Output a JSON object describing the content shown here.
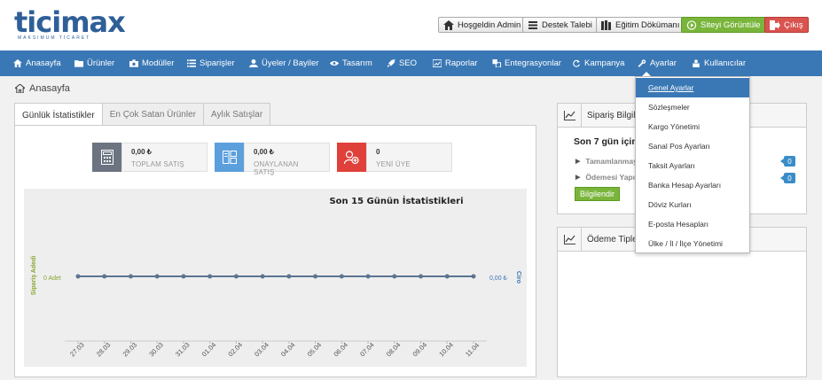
{
  "logo": {
    "name": "ticimax",
    "tagline": "MAKSIMUM TİCARET"
  },
  "header": {
    "welcome": "Hoşgeldin Admin",
    "support": "Destek Talebi",
    "docs": "Eğitim Dökümanı",
    "view_site": "Siteyi Görüntüle",
    "logout": "Çıkış"
  },
  "nav": {
    "items": [
      {
        "label": "Anasayfa",
        "icon": "home-icon"
      },
      {
        "label": "Ürünler",
        "icon": "folder-icon"
      },
      {
        "label": "Modüller",
        "icon": "camera-icon"
      },
      {
        "label": "Siparişler",
        "icon": "list-icon"
      },
      {
        "label": "Üyeler / Bayiler",
        "icon": "user-icon"
      },
      {
        "label": "Tasarım",
        "icon": "eye-icon"
      },
      {
        "label": "SEO",
        "icon": "rocket-icon"
      },
      {
        "label": "Raporlar",
        "icon": "chart-icon"
      },
      {
        "label": "Entegrasyonlar",
        "icon": "puzzle-icon"
      },
      {
        "label": "Kampanya",
        "icon": "refresh-icon"
      },
      {
        "label": "Ayarlar",
        "icon": "wrench-icon"
      },
      {
        "label": "Kullanıcılar",
        "icon": "user-lock-icon"
      }
    ]
  },
  "breadcrumb": {
    "label": "Anasayfa"
  },
  "tabs": [
    "Günlük İstatistikler",
    "En Çok Satan Ürünler",
    "Aylık Satışlar"
  ],
  "stats": [
    {
      "value": "0,00 ₺",
      "label": "TOPLAM SATIŞ",
      "color": "#6b7480"
    },
    {
      "value": "0,00 ₺",
      "label": "ONAYLANAN SATIŞ",
      "color": "#5b9fdc"
    },
    {
      "value": "0",
      "label": "YENİ ÜYE",
      "color": "#e0403a"
    }
  ],
  "chart_data": {
    "type": "line",
    "title": "Son 15 Günün İstatistikleri",
    "categories": [
      "27.03",
      "28.03",
      "29.03",
      "30.03",
      "31.03",
      "01.04",
      "02.04",
      "03.04",
      "04.04",
      "05.04",
      "06.04",
      "07.04",
      "08.04",
      "09.04",
      "10.04",
      "11.04"
    ],
    "series": [
      {
        "values": [
          0,
          0,
          0,
          0,
          0,
          0,
          0,
          0,
          0,
          0,
          0,
          0,
          0,
          0,
          0,
          0
        ]
      }
    ],
    "ylabel_left": "Sipariş Adedi",
    "ylabel_right": "Ciro",
    "left_tick": "0 Adet",
    "right_tick": "0,00 ₺",
    "colors": {
      "left_axis": "#8aa832",
      "right_axis": "#3a78b5",
      "line": "#5a7590"
    }
  },
  "panel_orders": {
    "title": "Sipariş Bilgile",
    "heading": "Son 7 gün içinde",
    "rows": [
      {
        "label": "Tamamlanmaya",
        "count": "0"
      },
      {
        "label": "Ödemesi Yapıl",
        "count": "0"
      }
    ],
    "button": "Bilgilendir"
  },
  "panel_payments": {
    "title": "Ödeme Tipler"
  },
  "dropdown": {
    "items": [
      "Genel Ayarlar",
      "Sözleşmeler",
      "Kargo Yönetimi",
      "Sanal Pos Ayarları",
      "Taksit Ayarları",
      "Banka Hesap Ayarları",
      "Döviz Kurları",
      "E-posta Hesapları",
      "Ülke / İl / İlçe Yönetimi"
    ],
    "active_index": 0
  }
}
